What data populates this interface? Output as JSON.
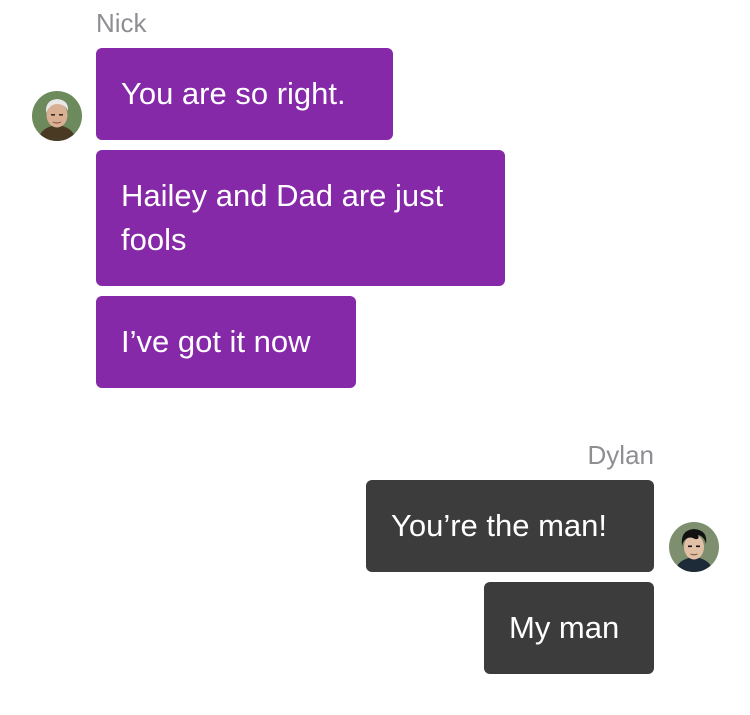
{
  "conversation": {
    "incoming": {
      "sender": "Nick",
      "avatar_icon": "person-avatar-icon",
      "messages": [
        {
          "text": "You are so right."
        },
        {
          "text": "Hailey and Dad are just fools"
        },
        {
          "text": "I’ve got it now"
        }
      ]
    },
    "outgoing": {
      "sender": "Dylan",
      "avatar_icon": "person-avatar-icon",
      "messages": [
        {
          "text": "You’re the man!"
        },
        {
          "text": "My man"
        }
      ]
    }
  },
  "colors": {
    "incoming_bubble": "#8529a8",
    "outgoing_bubble": "#3c3c3c",
    "sender_name": "#8e8e93",
    "background": "#ffffff"
  }
}
